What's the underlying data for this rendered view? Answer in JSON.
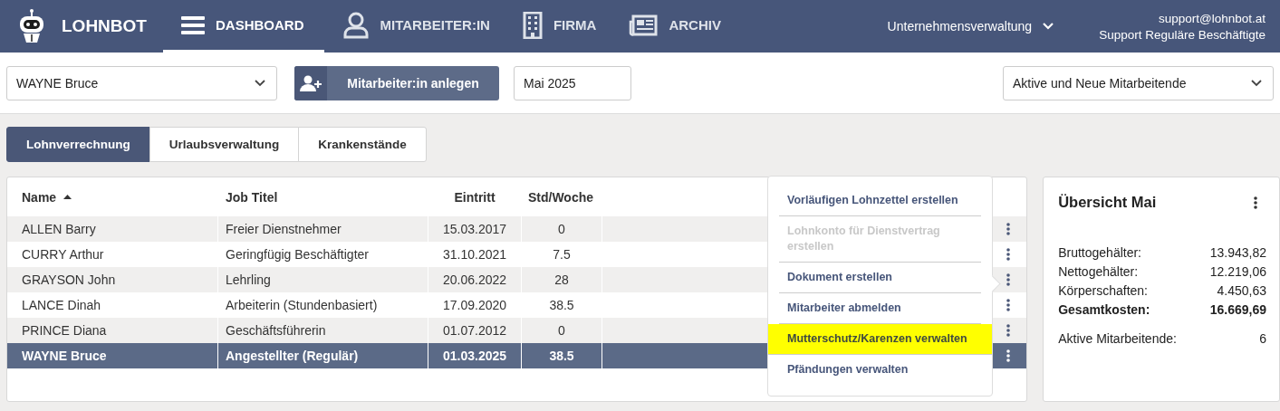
{
  "nav": {
    "brand": "LOHNBOT",
    "items": [
      {
        "label": "DASHBOARD",
        "selected": true
      },
      {
        "label": "MITARBEITER:IN",
        "selected": false
      },
      {
        "label": "FIRMA",
        "selected": false
      },
      {
        "label": "ARCHIV",
        "selected": false
      }
    ],
    "company_menu": "Unternehmensverwaltung",
    "user": {
      "email": "support@lohnbot.at",
      "role": "Support Reguläre Beschäftigte"
    }
  },
  "toolbar": {
    "employee_select": "WAYNE Bruce",
    "add_button": "Mitarbeiter:in anlegen",
    "month": "Mai 2025",
    "filter_select": "Aktive und Neue Mitarbeitende"
  },
  "tabs": [
    {
      "label": "Lohnverrechnung",
      "selected": true
    },
    {
      "label": "Urlaubsverwaltung",
      "selected": false
    },
    {
      "label": "Krankenstände",
      "selected": false
    }
  ],
  "table": {
    "columns": [
      {
        "label": "Name",
        "sorted": true
      },
      {
        "label": "Job Titel",
        "sorted": false
      },
      {
        "label": "Eintritt",
        "sorted": false
      },
      {
        "label": "Std/Woche",
        "sorted": false
      }
    ],
    "rows": [
      {
        "cells": [
          "ALLEN Barry",
          "Freier Dienstnehmer",
          "15.03.2017",
          "0"
        ],
        "selected": false
      },
      {
        "cells": [
          "CURRY Arthur",
          "Geringfügig Beschäftigter",
          "31.10.2021",
          "7.5"
        ],
        "selected": false
      },
      {
        "cells": [
          "GRAYSON John",
          "Lehrling",
          "20.06.2022",
          "28"
        ],
        "selected": false
      },
      {
        "cells": [
          "LANCE Dinah",
          "Arbeiterin (Stundenbasiert)",
          "17.09.2020",
          "38.5"
        ],
        "selected": false
      },
      {
        "cells": [
          "PRINCE Diana",
          "Geschäftsführerin",
          "01.07.2012",
          "0"
        ],
        "selected": false
      },
      {
        "cells": [
          "WAYNE Bruce",
          "Angestellter (Regulär)",
          "01.03.2025",
          "38.5"
        ],
        "selected": true
      }
    ]
  },
  "context_menu": {
    "items": [
      {
        "label": "Vorläufigen Lohnzettel erstellen",
        "disabled": false,
        "highlighted": false
      },
      {
        "label": "Lohnkonto für Dienstvertrag erstellen",
        "disabled": true,
        "highlighted": false
      },
      {
        "label": "Dokument erstellen",
        "disabled": false,
        "highlighted": false
      },
      {
        "label": "Mitarbeiter abmelden",
        "disabled": false,
        "highlighted": false
      },
      {
        "label": "Mutterschutz/Karenzen verwalten",
        "disabled": false,
        "highlighted": true
      },
      {
        "label": "Pfändungen verwalten",
        "disabled": false,
        "highlighted": false
      }
    ]
  },
  "summary": {
    "title": "Übersicht Mai",
    "lines": [
      {
        "label": "Bruttogehälter:",
        "value": "13.943,82",
        "bold": false
      },
      {
        "label": "Nettogehälter:",
        "value": "12.219,06",
        "bold": false
      },
      {
        "label": "Körperschaften:",
        "value": "4.450,63",
        "bold": false
      },
      {
        "label": "Gesamtkosten:",
        "value": "16.669,69",
        "bold": true
      }
    ],
    "active": {
      "label": "Aktive Mitarbeitende:",
      "value": "6"
    }
  }
}
